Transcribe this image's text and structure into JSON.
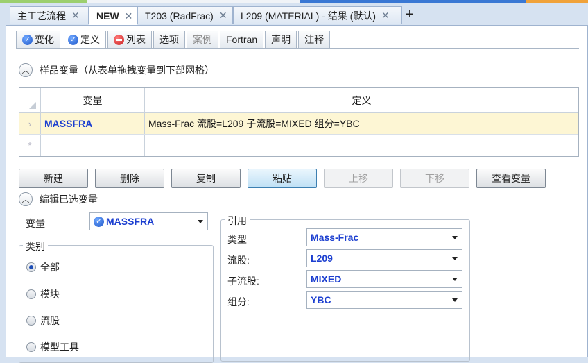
{
  "doc_tabs": [
    {
      "label": "主工艺流程",
      "active": false
    },
    {
      "label": "NEW",
      "active": true
    },
    {
      "label": "T203 (RadFrac)",
      "active": false
    },
    {
      "label": "L209 (MATERIAL) - 结果 (默认)",
      "active": false
    }
  ],
  "form_tabs": [
    {
      "label": "变化",
      "icon": "check-icon"
    },
    {
      "label": "定义",
      "icon": "check-icon"
    },
    {
      "label": "列表",
      "icon": "stop-icon"
    },
    {
      "label": "选项"
    },
    {
      "label": "案例"
    },
    {
      "label": "Fortran"
    },
    {
      "label": "声明"
    },
    {
      "label": "注释"
    }
  ],
  "sample_section": {
    "title": "样品变量（从表单拖拽变量到下部网格）"
  },
  "grid": {
    "headers": {
      "variable": "变量",
      "definition": "定义"
    },
    "rows": [
      {
        "variable": "MASSFRA",
        "definition": "Mass-Frac 流股=L209 子流股=MIXED 组分=YBC"
      }
    ],
    "new_row_marker": "*"
  },
  "buttons": {
    "new": "新建",
    "delete": "删除",
    "copy": "复制",
    "paste": "粘贴",
    "move_up": "上移",
    "move_down": "下移",
    "view_variable": "查看变量"
  },
  "edit_section": {
    "title": "编辑已选变量",
    "variable_label": "变量",
    "variable_value": "MASSFRA",
    "category": {
      "title": "类别",
      "options": [
        {
          "label": "全部",
          "checked": true
        },
        {
          "label": "模块",
          "checked": false
        },
        {
          "label": "流股",
          "checked": false
        },
        {
          "label": "模型工具",
          "checked": false
        }
      ]
    },
    "reference": {
      "title": "引用",
      "fields": [
        {
          "label": "类型",
          "value": "Mass-Frac"
        },
        {
          "label": "流股:",
          "value": "L209"
        },
        {
          "label": "子流股:",
          "value": "MIXED"
        },
        {
          "label": "组分:",
          "value": "YBC"
        }
      ]
    }
  },
  "colors": {
    "accent_blue": "#1c3fd0",
    "selected_row": "#fdf6d4"
  }
}
